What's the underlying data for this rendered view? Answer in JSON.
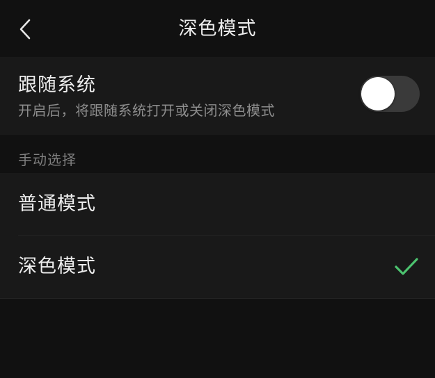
{
  "header": {
    "title": "深色模式",
    "back_icon": "chevron-left-icon"
  },
  "follow_system": {
    "title": "跟随系统",
    "description": "开启后，将跟随系统打开或关闭深色模式",
    "toggle_on": false
  },
  "manual": {
    "section_label": "手动选择",
    "options": [
      {
        "label": "普通模式",
        "selected": false
      },
      {
        "label": "深色模式",
        "selected": true
      }
    ],
    "check_icon": "checkmark-icon"
  },
  "colors": {
    "background": "#111111",
    "card": "#191919",
    "accent_check": "#4cc36f",
    "toggle_track": "#3a3a3a",
    "toggle_knob": "#ffffff"
  }
}
